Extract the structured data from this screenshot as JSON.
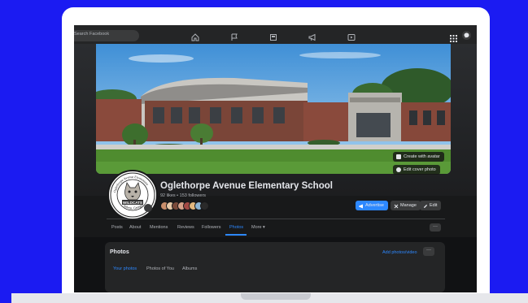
{
  "topbar": {
    "search_placeholder": "Search Facebook",
    "nav_icons": [
      "home-icon",
      "pages-flag-icon",
      "marketplace-icon",
      "megaphone-icon",
      "watch-icon"
    ]
  },
  "cover": {
    "create_avatar_label": "Create with avatar",
    "edit_cover_label": "Edit cover photo"
  },
  "profile": {
    "name": "Oglethorpe Avenue Elementary School",
    "stats": "92 likes • 153 followers",
    "logo_text": [
      "Oglethorpe Avenue Elementary",
      "WILDCATS",
      "Athens, Georgia"
    ]
  },
  "actions": {
    "advertise": "Advertise",
    "manage": "Manage",
    "edit": "Edit"
  },
  "tabs": [
    "Posts",
    "About",
    "Mentions",
    "Reviews",
    "Followers",
    "Photos",
    "More ▾"
  ],
  "active_tab": "Photos",
  "more_dots": "···",
  "photos": {
    "title": "Photos",
    "add_link": "Add photos/video",
    "subtabs": [
      "Your photos",
      "Photos of You",
      "Albums"
    ]
  },
  "colors": {
    "background": "#1b1bf2",
    "accent": "#2d88ff",
    "fb_dark": "#18191a"
  }
}
